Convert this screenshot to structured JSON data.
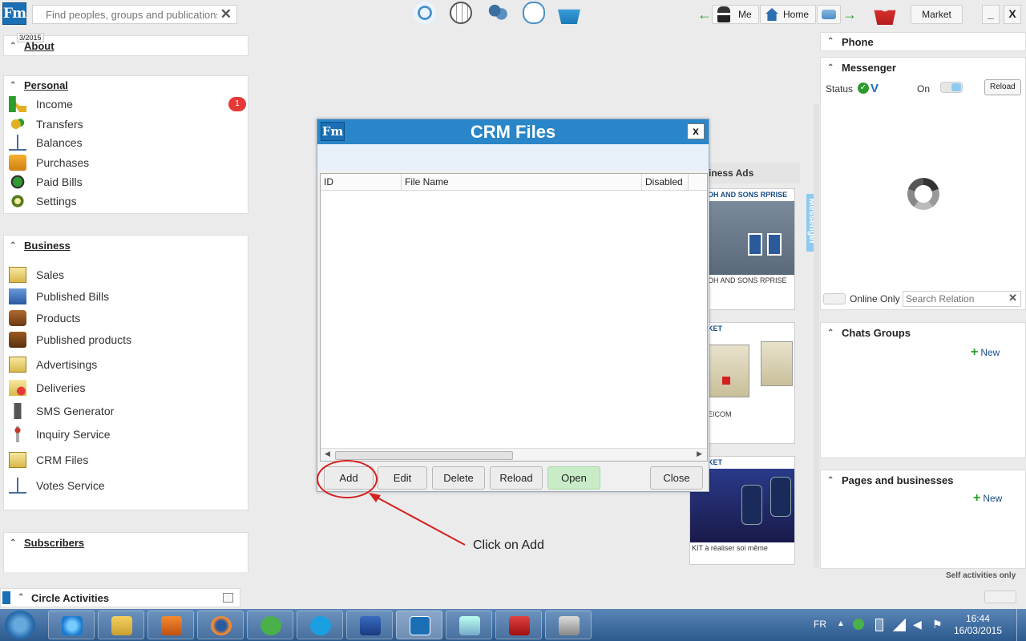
{
  "topbar": {
    "search_placeholder": "Find peoples, groups and publications",
    "me_label": "Me",
    "home_label": "Home",
    "market_label": "Market",
    "minimize": "_",
    "close": "X"
  },
  "left": {
    "about_date": "3/2015",
    "about_title": "About",
    "personal_title": "Personal",
    "income_badge": "1",
    "personal_items": [
      "Income",
      "Transfers",
      "Balances",
      "Purchases",
      "Paid Bills",
      "Settings"
    ],
    "business_title": "Business",
    "business_items": [
      "Sales",
      "Published Bills",
      "Products",
      "Published products",
      "Advertisings",
      "Deliveries",
      "SMS Generator",
      "Inquiry Service",
      "CRM Files",
      "Votes Service"
    ],
    "subscribers_title": "Subscribers",
    "circle_title": "Circle Activities"
  },
  "ads": {
    "header": "iness Ads",
    "card1_title": "OH AND SONS RPRISE",
    "card1_caption": "OH AND SONS RPRISE",
    "card2_title": "KET",
    "card2_caption": "EICOM",
    "card3_title": "KET",
    "card3_caption": "KIT à réaliser soi même"
  },
  "dialog": {
    "title": "CRM Files",
    "close": "x",
    "columns": [
      "ID",
      "File Name",
      "Disabled"
    ],
    "buttons": {
      "add": "Add",
      "edit": "Edit",
      "delete": "Delete",
      "reload": "Reload",
      "open": "Open",
      "close": "Close"
    }
  },
  "annotation": {
    "callout": "Click on Add"
  },
  "right": {
    "phone_title": "Phone",
    "messenger_title": "Messenger",
    "status_label": "Status",
    "on_label": "On",
    "reload_label": "Reload",
    "side_tab": "Messenger",
    "online_only": "Online Only",
    "search_placeholder": "Search Relation",
    "chats_title": "Chats Groups",
    "new_label": "New",
    "pages_title": "Pages and businesses",
    "new_label2": "New",
    "self_activities": "Self activities only"
  },
  "taskbar": {
    "lang": "FR",
    "time": "16:44",
    "date": "16/03/2015"
  }
}
